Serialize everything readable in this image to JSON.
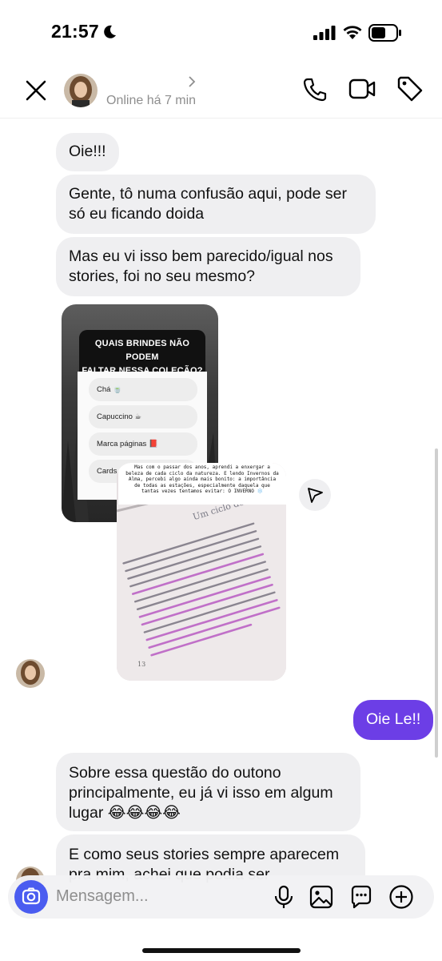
{
  "status_bar": {
    "time": "21:57"
  },
  "header": {
    "status": "Online há 7 min"
  },
  "messages": [
    {
      "text": "Oie!!!"
    },
    {
      "line1": "Gente, tô numa confusão aqui, pode ser",
      "line2": "só eu ficando doida"
    },
    {
      "line1": "Mas eu vi isso bem parecido/igual nos",
      "line2": "stories, foi no seu mesmo?"
    },
    {
      "text": "Oie Le!!"
    },
    {
      "line1": "Sobre essa questão do outono",
      "line2": "principalmente, eu já vi isso em algum",
      "line3": "lugar 😂😂😂😂"
    },
    {
      "line1": "E como seus stories sempre aparecem",
      "line2": "pra mim, achei que podia ser"
    }
  ],
  "story_quiz": {
    "title_line1": "QUAIS BRINDES NÃO PODEM",
    "title_line2": "FALTAR NESSA COLEÇÃO?",
    "options": [
      "Chá 🍵",
      "Capuccino ☕",
      "Marca páginas 📕",
      "Cards tem"
    ]
  },
  "story_book": {
    "caption": "Mas com o passar dos anos, aprendi a enxergar a beleza de cada ciclo da natureza. E lendo Invernos da Alma, percebi algo ainda mais bonito: a importância de todas as estações, especialmente daquela que tantas vezes tentamos evitar: O INVERNO ❄️",
    "heading": "Um ciclo de inve",
    "page_number": "13"
  },
  "composer": {
    "placeholder": "Mensagem..."
  },
  "colors": {
    "outgoing_bubble": "#6c3ee6",
    "incoming_bubble": "#efeff1",
    "camera_button": "#4a5cf0"
  }
}
